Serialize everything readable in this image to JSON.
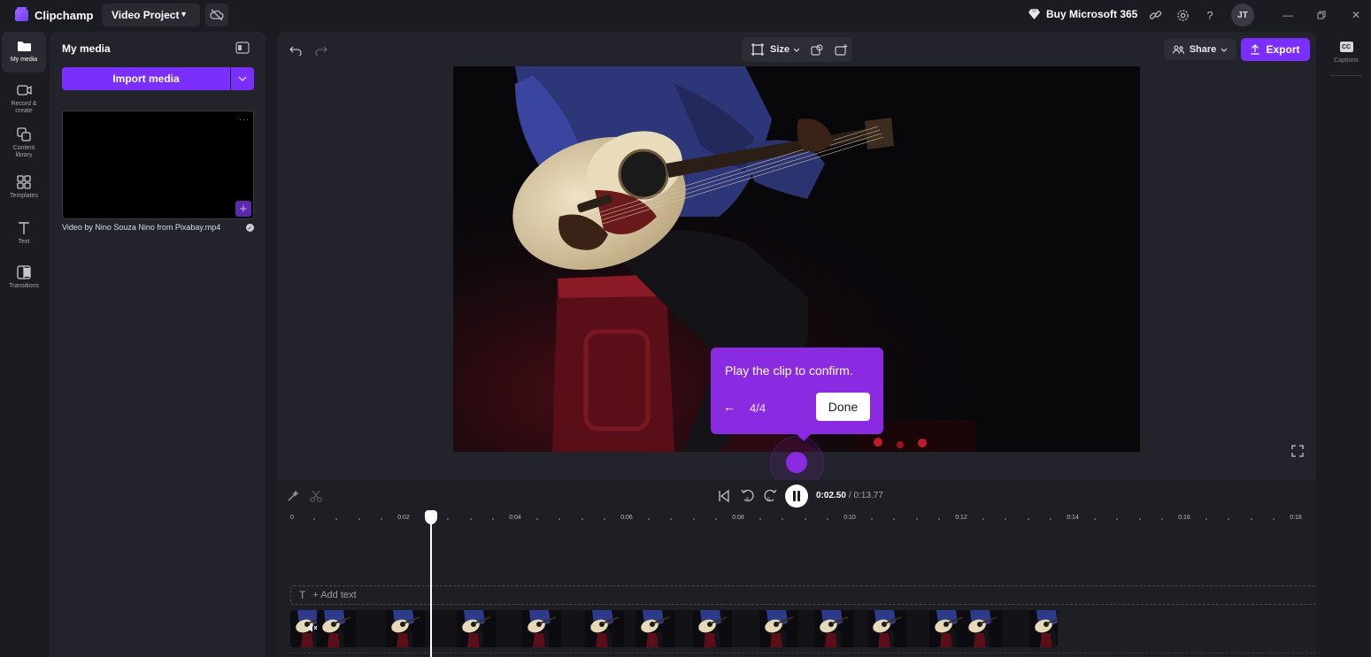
{
  "app": {
    "name": "Clipchamp",
    "project_title": "Video Project"
  },
  "header": {
    "buy_label": "Buy Microsoft 365",
    "avatar_initials": "JT"
  },
  "nav": {
    "items": [
      {
        "label": "My media",
        "icon": "folder-icon"
      },
      {
        "label": "Record & create",
        "icon": "camera-icon"
      },
      {
        "label": "Content library",
        "icon": "library-icon"
      },
      {
        "label": "Templates",
        "icon": "templates-icon"
      },
      {
        "label": "Text",
        "icon": "text-icon"
      },
      {
        "label": "Transitions",
        "icon": "transitions-icon"
      }
    ]
  },
  "media": {
    "title": "My media",
    "import_label": "Import media",
    "file_name": "Video by Nino Souza Nino from Pixabay.mp4"
  },
  "toolbar": {
    "size_label": "Size",
    "share_label": "Share",
    "export_label": "Export"
  },
  "tour": {
    "message": "Play the clip to confirm.",
    "step": "4/4",
    "done_label": "Done",
    "back_icon": "arrow-left-icon"
  },
  "timeline": {
    "current_time": "0:02.50",
    "total_time": "/ 0:13.77",
    "ruler_labels": [
      "0",
      "0:02",
      "0:04",
      "0:06",
      "0:08",
      "0:10",
      "0:12",
      "0:14",
      "0:16",
      "0:18"
    ],
    "add_text_label": "+ Add text"
  },
  "rightpanel": {
    "captions_label": "Captions",
    "cc": "CC"
  },
  "colors": {
    "accent": "#7b2fff",
    "tour": "#8a2be2",
    "bg": "#1b1b22",
    "panel": "#23232b"
  }
}
